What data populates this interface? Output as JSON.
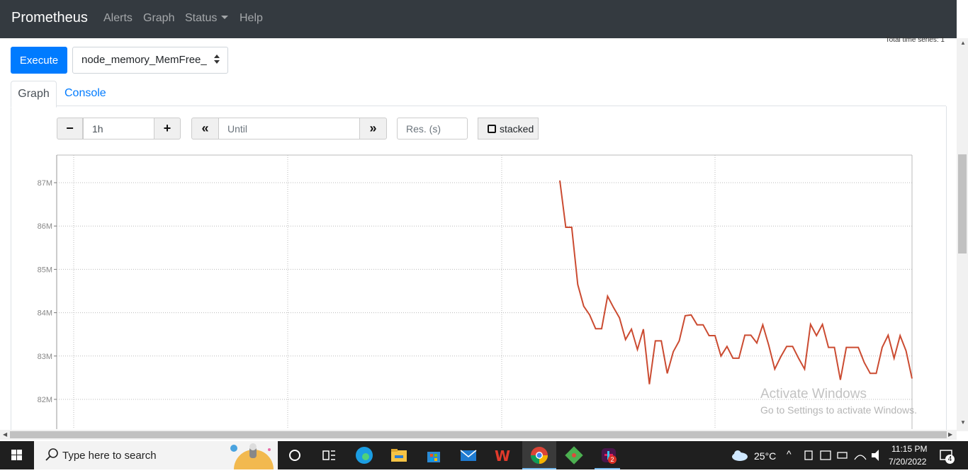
{
  "navbar": {
    "brand": "Prometheus",
    "items": [
      {
        "label": "Alerts"
      },
      {
        "label": "Graph"
      },
      {
        "label": "Status"
      },
      {
        "label": "Help"
      }
    ]
  },
  "query": {
    "execute_label": "Execute",
    "metric_selected": "node_memory_MemFree_",
    "total_series_text": "Total time series: 1"
  },
  "tabs": {
    "graph": "Graph",
    "console": "Console"
  },
  "controls": {
    "minus_label": "−",
    "range_value": "1h",
    "plus_label": "+",
    "back_label": "«",
    "until_placeholder": "Until",
    "forward_label": "»",
    "resolution_placeholder": "Res. (s)",
    "stacked_label": "stacked"
  },
  "chart_data": {
    "type": "line",
    "title": "",
    "xlabel": "",
    "ylabel": "",
    "y_ticks": [
      "82M",
      "83M",
      "84M",
      "85M",
      "86M",
      "87M"
    ],
    "ylim": [
      81.3,
      87.6
    ],
    "grid": true,
    "series": [
      {
        "color": "#cb4b31",
        "x": [
          0,
          0.5,
          1,
          1.5,
          2,
          2.5,
          3,
          3.5,
          4,
          4.5,
          5,
          5.5,
          6,
          6.5,
          7,
          7.5,
          8,
          8.5,
          9,
          9.5,
          10,
          10.5,
          11,
          11.5,
          12,
          12.5,
          13,
          13.5,
          14,
          14.5,
          15,
          15.5,
          16,
          16.5,
          17,
          17.5,
          18,
          18.5,
          19,
          19.5,
          20,
          20.5,
          21,
          21.5,
          22,
          22.5,
          23,
          23.5,
          24,
          24.5,
          25,
          25.5,
          26,
          26.5,
          27,
          27.5,
          28,
          28.5,
          29,
          29.5
        ],
        "y": [
          87.05,
          85.97,
          85.97,
          84.65,
          84.15,
          83.95,
          83.63,
          83.63,
          84.38,
          84.12,
          83.88,
          83.38,
          83.62,
          83.15,
          83.62,
          82.35,
          83.35,
          83.35,
          82.6,
          83.1,
          83.35,
          83.93,
          83.95,
          83.72,
          83.72,
          83.47,
          83.47,
          83.0,
          83.22,
          82.95,
          82.95,
          83.48,
          83.48,
          83.3,
          83.72,
          83.25,
          82.7,
          82.98,
          83.22,
          83.22,
          82.95,
          82.7,
          83.73,
          83.47,
          83.73,
          83.2,
          83.2,
          82.45,
          83.2,
          83.2,
          83.2,
          82.85,
          82.6,
          82.6,
          83.2,
          83.48,
          82.95,
          83.47,
          83.12,
          82.48
        ],
        "note": "point x values are sample indices on an unlabeled time span"
      }
    ]
  },
  "watermark": {
    "title": "Activate Windows",
    "subtitle": "Go to Settings to activate Windows."
  },
  "taskbar": {
    "search_placeholder": "Type here to search",
    "temperature": "25°C",
    "time": "11:15 PM",
    "date": "7/20/2022",
    "notification_count": "4",
    "slack_badge": "2"
  }
}
